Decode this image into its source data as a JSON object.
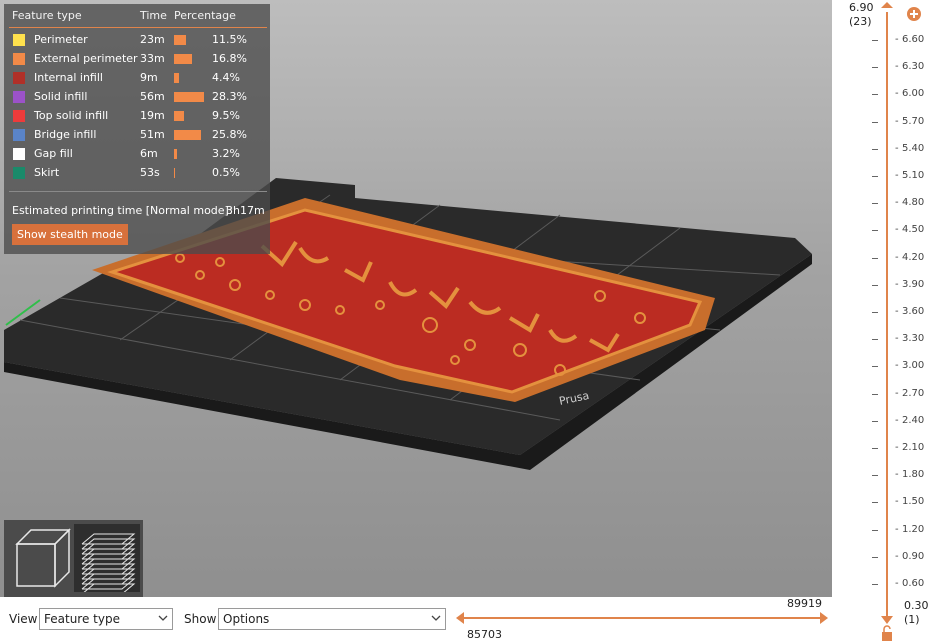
{
  "legend": {
    "headers": {
      "feature": "Feature type",
      "time": "Time",
      "percentage": "Percentage"
    },
    "rows": [
      {
        "name": "Perimeter",
        "time": "23m",
        "pct": "11.5%",
        "fraction": 0.115,
        "color": "#ffe14d"
      },
      {
        "name": "External perimeter",
        "time": "33m",
        "pct": "16.8%",
        "fraction": 0.168,
        "color": "#f28a48"
      },
      {
        "name": "Internal infill",
        "time": "9m",
        "pct": "4.4%",
        "fraction": 0.044,
        "color": "#b03028"
      },
      {
        "name": "Solid infill",
        "time": "56m",
        "pct": "28.3%",
        "fraction": 0.283,
        "color": "#9b52c8"
      },
      {
        "name": "Top solid infill",
        "time": "19m",
        "pct": "9.5%",
        "fraction": 0.095,
        "color": "#ee3b3b"
      },
      {
        "name": "Bridge infill",
        "time": "51m",
        "pct": "25.8%",
        "fraction": 0.258,
        "color": "#5a84c8"
      },
      {
        "name": "Gap fill",
        "time": "6m",
        "pct": "3.2%",
        "fraction": 0.032,
        "color": "#ffffff"
      },
      {
        "name": "Skirt",
        "time": "53s",
        "pct": "0.5%",
        "fraction": 0.005,
        "color": "#1a8a6a"
      }
    ],
    "estimated_label": "Estimated printing time [Normal mode]:",
    "estimated_value": "3h17m",
    "stealth_button": "Show stealth mode"
  },
  "view_toggles": {
    "three_d": "3D view",
    "preview": "Preview"
  },
  "vertical_slider": {
    "top_value": "6.90",
    "top_index": "(23)",
    "bottom_value": "0.30",
    "bottom_index": "(1)",
    "ticks": [
      "6.60",
      "6.30",
      "6.00",
      "5.70",
      "5.40",
      "5.10",
      "4.80",
      "4.50",
      "4.20",
      "3.90",
      "3.60",
      "3.30",
      "3.00",
      "2.70",
      "2.40",
      "2.10",
      "1.80",
      "1.50",
      "1.20",
      "0.90",
      "0.60"
    ],
    "accent": "#e0844b"
  },
  "bottom": {
    "view_label": "View",
    "view_value": "Feature type",
    "show_label": "Show",
    "show_value": "Options",
    "h_max": "89919",
    "h_min": "85703"
  },
  "bed": {
    "brand_text": "Prusa"
  }
}
